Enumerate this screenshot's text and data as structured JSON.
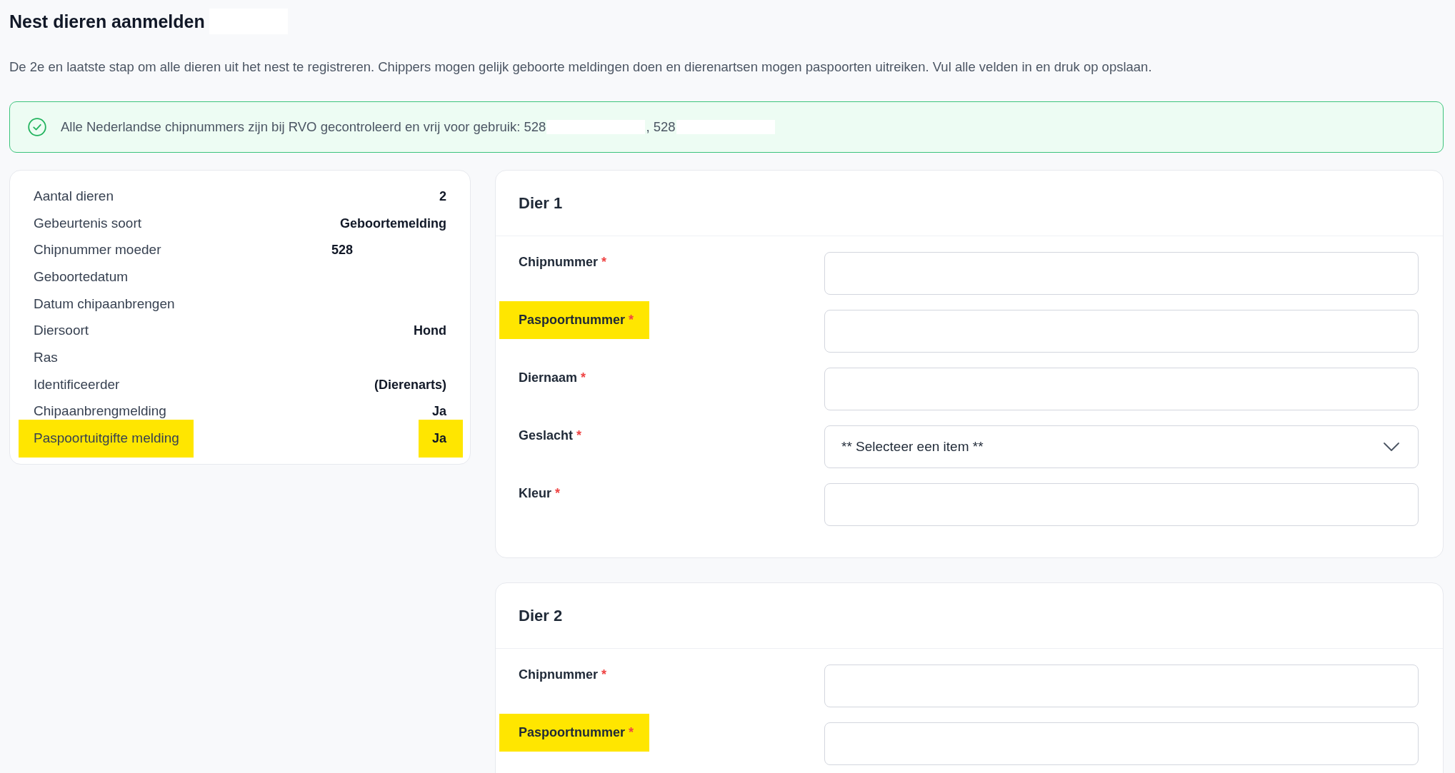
{
  "page": {
    "title": "Nest dieren aanmelden",
    "title_redacted": true,
    "description": "De 2e en laatste stap om alle dieren uit het nest te registreren. Chippers mogen gelijk geboorte meldingen doen en dierenartsen mogen paspoorten uitreiken. Vul alle velden in en druk op opslaan."
  },
  "alert": {
    "kind": "success",
    "segments": [
      {
        "text": "Alle Nederlandse chipnummers zijn bij RVO gecontroleerd en vrij voor gebruik: 528",
        "redacted_after": true
      },
      {
        "text": ", 528",
        "redacted_after": true
      }
    ]
  },
  "summary": {
    "rows": [
      {
        "label": "Aantal dieren",
        "label_highlighted": false,
        "value": "2",
        "value_highlighted": false,
        "value_redacted": false
      },
      {
        "label": "Gebeurtenis soort",
        "label_highlighted": false,
        "value": "Geboortemelding",
        "value_highlighted": false,
        "value_redacted": false
      },
      {
        "label": "Chipnummer moeder",
        "label_highlighted": false,
        "value": "528",
        "value_highlighted": false,
        "value_redacted": true
      },
      {
        "label": "Geboortedatum",
        "label_highlighted": false
      },
      {
        "label": "Datum chipaanbrengen",
        "label_highlighted": false
      },
      {
        "label": "Diersoort",
        "label_highlighted": false,
        "value": "Hond",
        "value_highlighted": false,
        "value_redacted": false
      },
      {
        "label": "Ras",
        "label_highlighted": false
      },
      {
        "label": "Identificeerder",
        "label_highlighted": false,
        "value": "(Dierenarts)",
        "value_highlighted": false,
        "value_redacted": false
      },
      {
        "label": "Chipaanbrengmelding",
        "label_highlighted": false,
        "value": "Ja",
        "value_highlighted": false,
        "value_redacted": false
      },
      {
        "label": "Paspoortuitgifte melding",
        "label_highlighted": true,
        "value": "Ja",
        "value_highlighted": true,
        "value_redacted": false
      }
    ]
  },
  "animals": [
    {
      "title": "Dier 1",
      "fields": [
        {
          "label": "Chipnummer",
          "required_mark": "*",
          "highlighted": false,
          "kind": "text"
        },
        {
          "label": "Paspoortnummer",
          "required_mark": "*",
          "highlighted": true,
          "kind": "text"
        },
        {
          "label": "Diernaam",
          "required_mark": "*",
          "highlighted": false,
          "kind": "text"
        },
        {
          "label": "Geslacht",
          "required_mark": "*",
          "highlighted": false,
          "kind": "select",
          "placeholder": "** Selecteer een item **"
        },
        {
          "label": "Kleur",
          "required_mark": "*",
          "highlighted": false,
          "kind": "text"
        }
      ]
    },
    {
      "title": "Dier 2",
      "fields": [
        {
          "label": "Chipnummer",
          "required_mark": "*",
          "highlighted": false,
          "kind": "text"
        },
        {
          "label": "Paspoortnummer",
          "required_mark": "*",
          "highlighted": true,
          "kind": "text"
        }
      ]
    }
  ]
}
